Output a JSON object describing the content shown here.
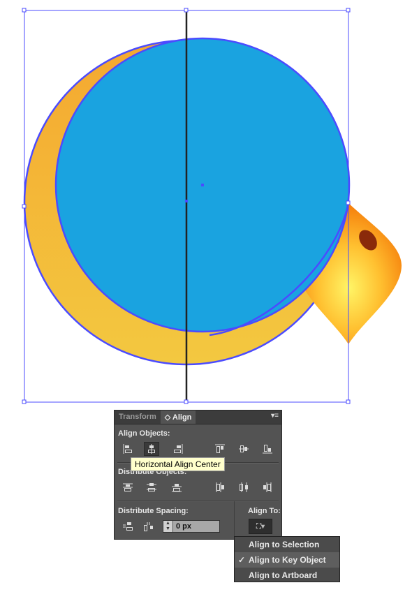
{
  "colors": {
    "circle": "#1aa3e0",
    "crescent": "#f4b43a",
    "beak": "#ff9a1a",
    "selection": "#4b4bff",
    "panel": "#535353"
  },
  "panel": {
    "tabs": [
      {
        "label": "Transform"
      },
      {
        "label": "◇ Align"
      }
    ],
    "menu_icon": "panel-menu-icon",
    "align_objects_label": "Align Objects:",
    "distribute_objects_label": "Distribute Objects:",
    "distribute_spacing_label": "Distribute Spacing:",
    "align_to_label": "Align To:",
    "spacing_value": "0 px"
  },
  "tooltip": "Horizontal Align Center",
  "dropdown": {
    "items": [
      {
        "label": "Align to Selection",
        "checked": false
      },
      {
        "label": "Align to Key Object",
        "checked": true
      },
      {
        "label": "Align to Artboard",
        "checked": false
      }
    ]
  }
}
